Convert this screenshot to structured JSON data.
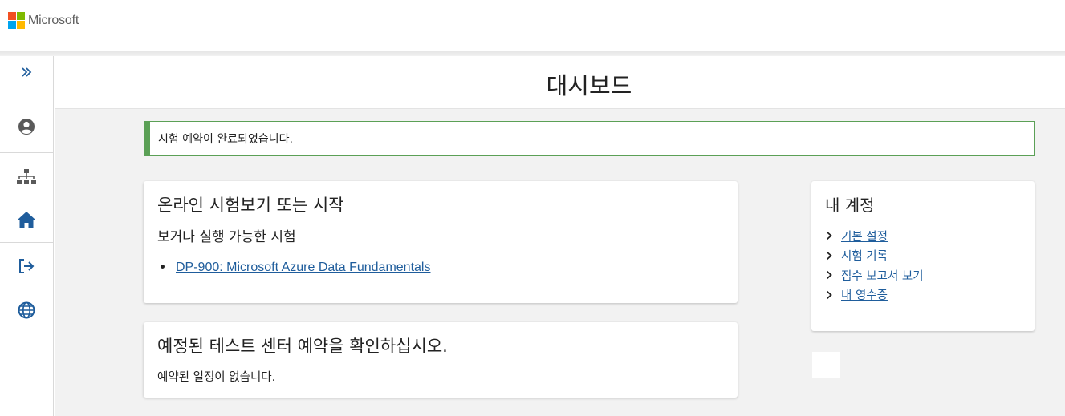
{
  "brand": {
    "name": "Microsoft",
    "colors": [
      "#f25022",
      "#7fba00",
      "#00a4ef",
      "#ffb900"
    ]
  },
  "sidebar": {
    "accent": "#1f5d9c",
    "items": [
      {
        "name": "expand",
        "icon": "double-chevron-right-icon"
      },
      {
        "name": "profile",
        "icon": "user-circle-icon"
      },
      {
        "name": "sitemap",
        "icon": "sitemap-icon"
      },
      {
        "name": "home",
        "icon": "home-icon"
      },
      {
        "name": "sign-out",
        "icon": "sign-out-icon"
      },
      {
        "name": "language",
        "icon": "globe-icon"
      }
    ]
  },
  "page": {
    "title": "대시보드"
  },
  "alert": {
    "message": "시험 예약이 완료되었습니다.",
    "color": "#5ba056"
  },
  "online_exam": {
    "title": "온라인 시험보기 또는 시작",
    "subtitle": "보거나 실행 가능한 시험",
    "exams": [
      "DP-900: Microsoft Azure Data Fundamentals"
    ]
  },
  "test_center": {
    "title": "예정된 테스트 센터 예약을 확인하십시오.",
    "empty_message": "예약된 일정이 없습니다."
  },
  "account": {
    "title": "내 계정",
    "links": [
      "기본 설정",
      "시험 기록",
      "점수 보고서 보기",
      "내 영수증"
    ]
  }
}
